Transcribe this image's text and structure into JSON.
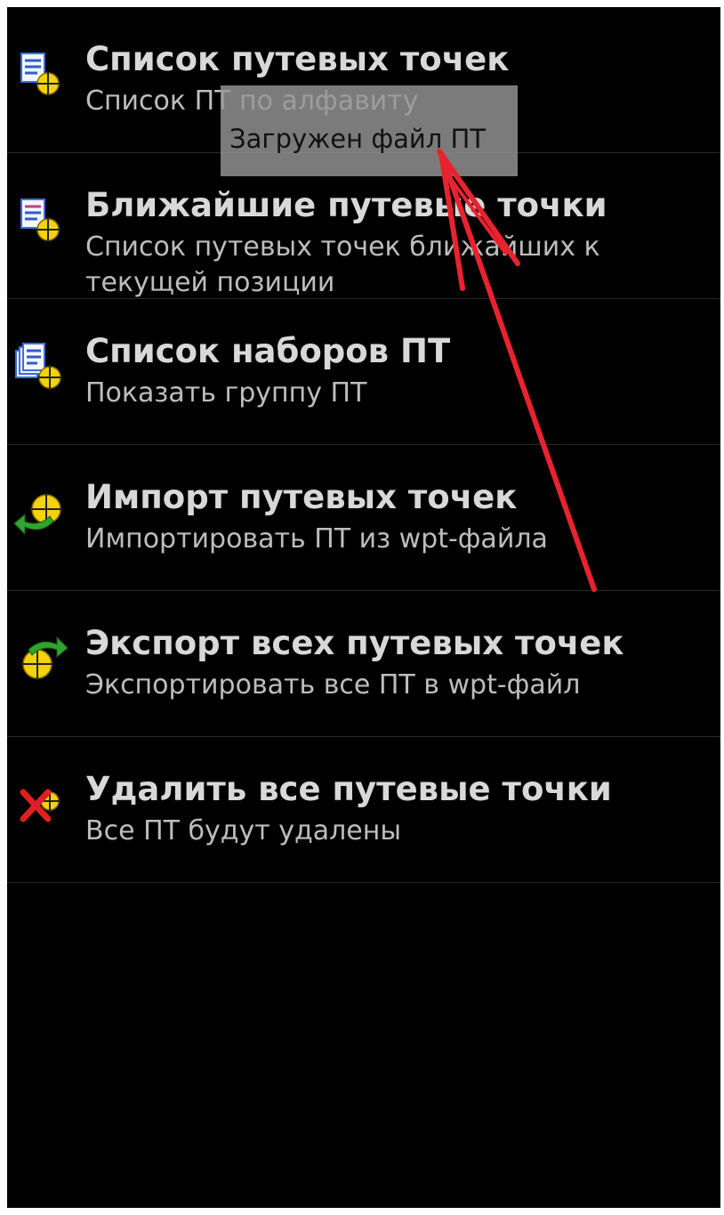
{
  "menu": {
    "items": [
      {
        "title": "Список путевых точек",
        "subtitle": "Список ПТ по алфавиту",
        "icon": "waypoint-list-icon"
      },
      {
        "title": "Ближайшие путевые точки",
        "subtitle": "Список путевых точек ближайших к текущей позиции",
        "icon": "nearest-waypoints-icon"
      },
      {
        "title": "Список наборов ПТ",
        "subtitle": "Показать группу ПТ",
        "icon": "waypoint-sets-icon"
      },
      {
        "title": "Импорт путевых точек",
        "subtitle": "Импортировать ПТ из wpt-файла",
        "icon": "import-waypoints-icon"
      },
      {
        "title": "Экспорт всех путевых точек",
        "subtitle": "Экспортировать все ПТ в wpt-файл",
        "icon": "export-waypoints-icon"
      },
      {
        "title": "Удалить все путевые точки",
        "subtitle": "Все ПТ будут удалены",
        "icon": "delete-waypoints-icon"
      }
    ]
  },
  "toast": {
    "message": "Загружен файл ПТ"
  },
  "colors": {
    "background": "#000000",
    "title": "#d8d8d8",
    "subtitle": "#bdbdbd",
    "toast": "#969696",
    "annotation_arrow": "#e8232f",
    "icon_yellow": "#f5d20a",
    "icon_green": "#2fa52f",
    "icon_red": "#e02020"
  }
}
